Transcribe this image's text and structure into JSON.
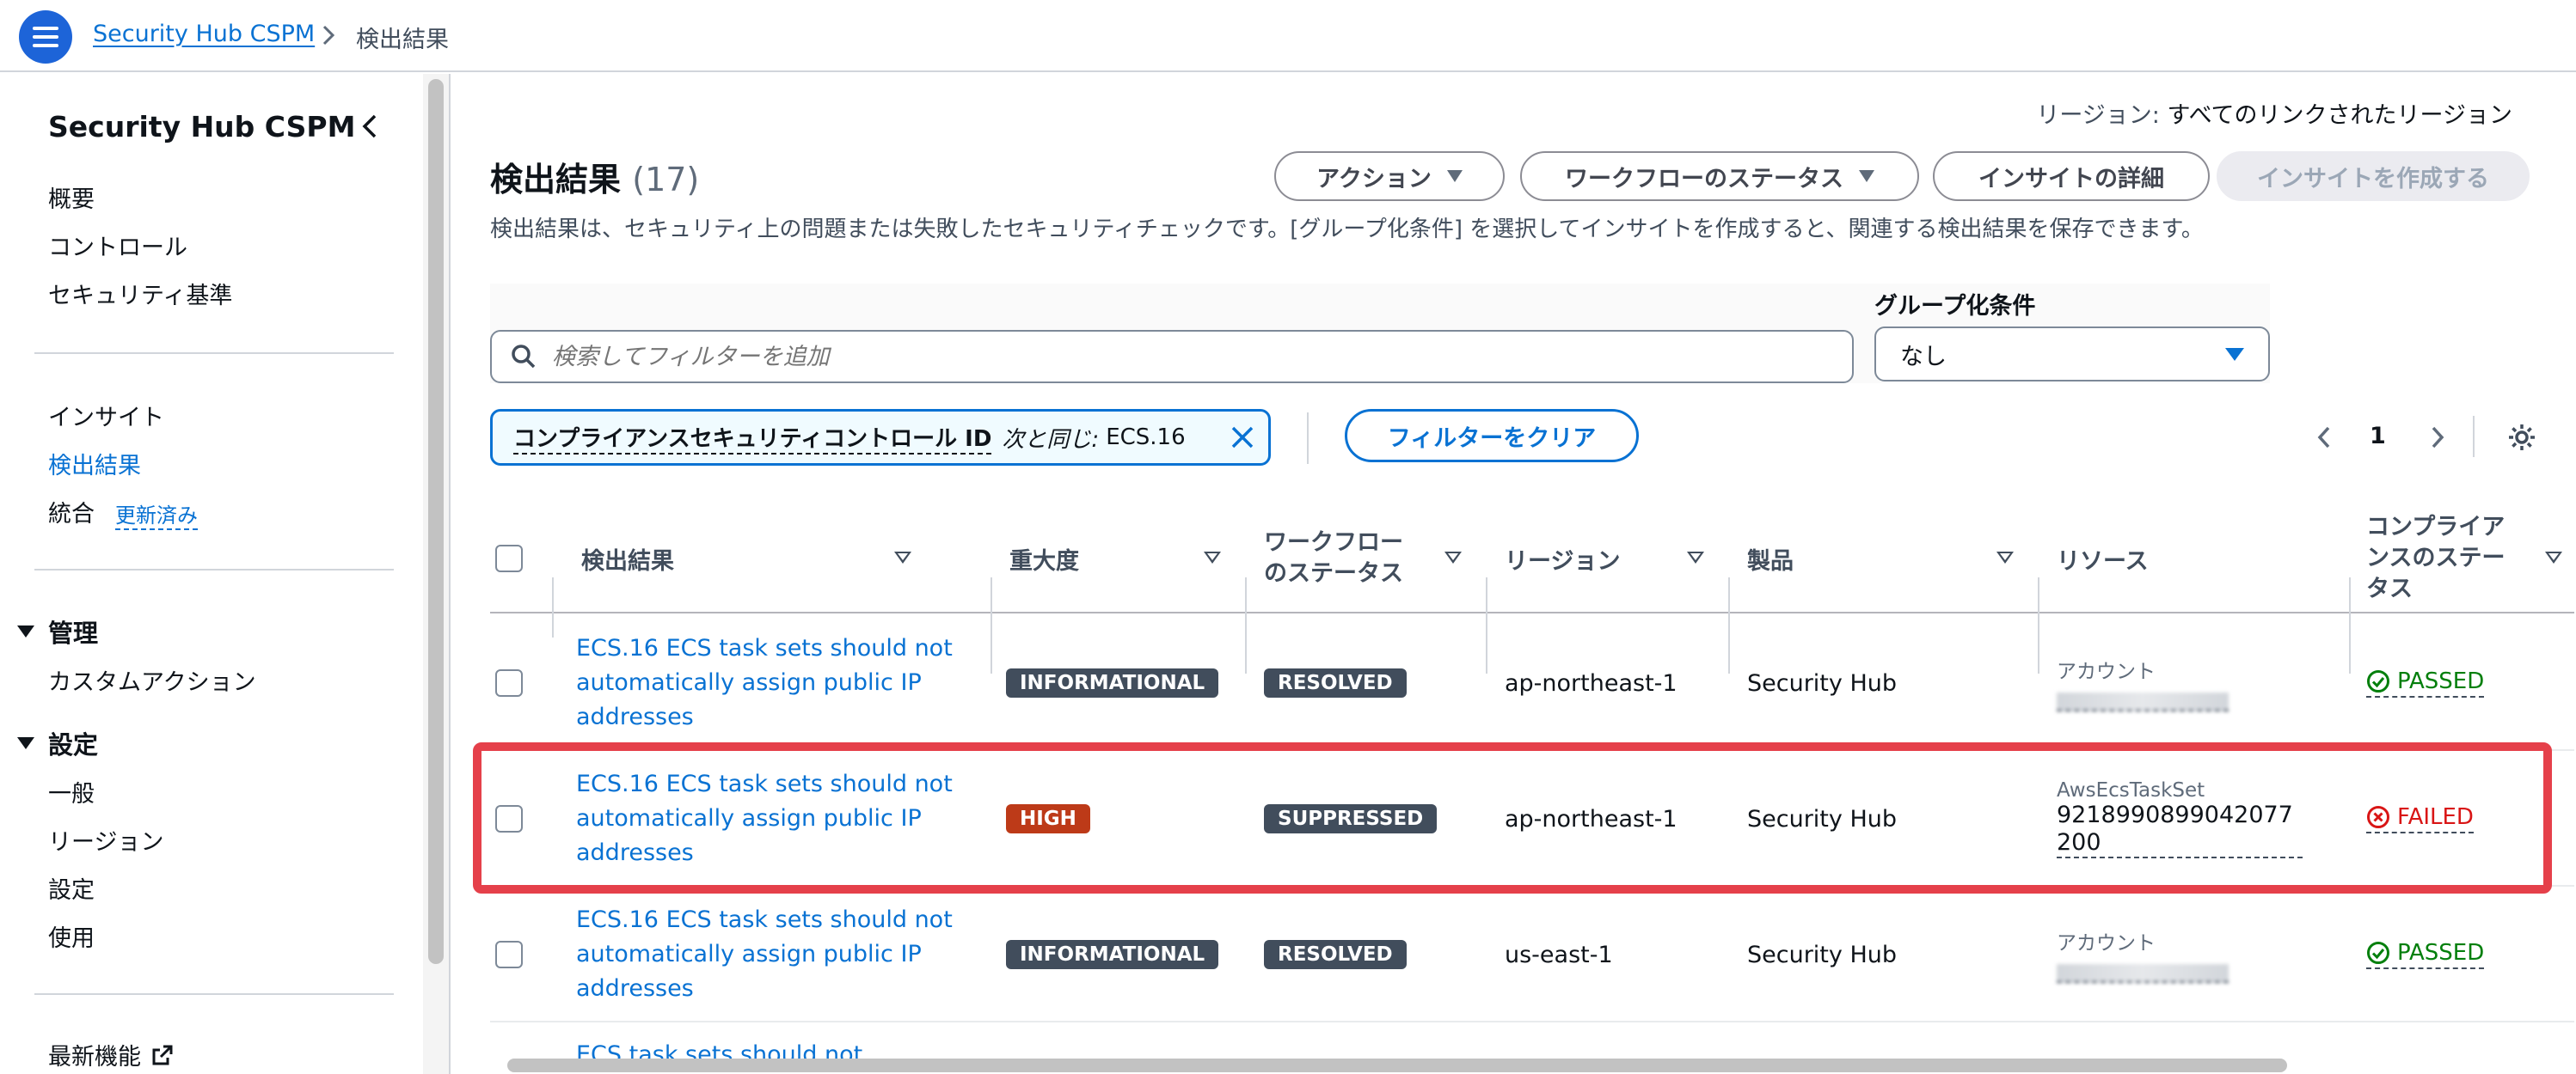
{
  "breadcrumb": {
    "root": "Security Hub CSPM",
    "current": "検出結果"
  },
  "sidebar": {
    "title": "Security Hub CSPM",
    "group1": [
      "概要",
      "コントロール",
      "セキュリティ基準"
    ],
    "group2": [
      "インサイト",
      "検出結果",
      "統合"
    ],
    "updated_badge": "更新済み",
    "section_manage": "管理",
    "manage_items": [
      "カスタムアクション"
    ],
    "section_settings": "設定",
    "settings_items": [
      "一般",
      "リージョン",
      "設定",
      "使用"
    ],
    "whats_new": "最新機能"
  },
  "header": {
    "region_prefix": "リージョン:",
    "region_value": "すべてのリンクされたリージョン",
    "title": "検出結果",
    "count": "(17)",
    "btn_actions": "アクション",
    "btn_workflow": "ワークフローのステータス",
    "btn_insight_details": "インサイトの詳細",
    "btn_create_insight": "インサイトを作成する",
    "description": "検出結果は、セキュリティ上の問題または失敗したセキュリティチェックです。[グループ化条件] を選択してインサイトを作成すると、関連する検出結果を保存できます。"
  },
  "search": {
    "placeholder": "検索してフィルターを追加"
  },
  "group_by": {
    "label": "グループ化条件",
    "value": "なし"
  },
  "filter_token": {
    "key": "コンプライアンスセキュリティコントロール ID",
    "operator": "次と同じ:",
    "value": "ECS.16"
  },
  "clear_filter": "フィルターをクリア",
  "pagination": {
    "page": "1"
  },
  "table": {
    "columns": [
      "検出結果",
      "重大度",
      "ワークフローのステータス",
      "リージョン",
      "製品",
      "リソース",
      "コンプライアンスのステータス"
    ],
    "rows": [
      {
        "finding": "ECS.16 ECS task sets should not automatically assign public IP addresses",
        "severity": "INFORMATIONAL",
        "workflow": "RESOLVED",
        "region": "ap-northeast-1",
        "product": "Security Hub",
        "resource_label": "アカウント",
        "resource_value": "",
        "compliance": "PASSED"
      },
      {
        "finding": "ECS.16 ECS task sets should not automatically assign public IP addresses",
        "severity": "HIGH",
        "workflow": "SUPPRESSED",
        "region": "ap-northeast-1",
        "product": "Security Hub",
        "resource_label": "AwsEcsTaskSet",
        "resource_value": "9218990899042077200",
        "compliance": "FAILED"
      },
      {
        "finding": "ECS.16 ECS task sets should not automatically assign public IP addresses",
        "severity": "INFORMATIONAL",
        "workflow": "RESOLVED",
        "region": "us-east-1",
        "product": "Security Hub",
        "resource_label": "アカウント",
        "resource_value": "",
        "compliance": "PASSED"
      }
    ],
    "partial_row": "ECS task sets should not"
  },
  "colors": {
    "accent": "#0972d3",
    "high": "#bd3a18",
    "passed": "#037f0c",
    "failed": "#d91515",
    "highlight": "#e5404a"
  }
}
